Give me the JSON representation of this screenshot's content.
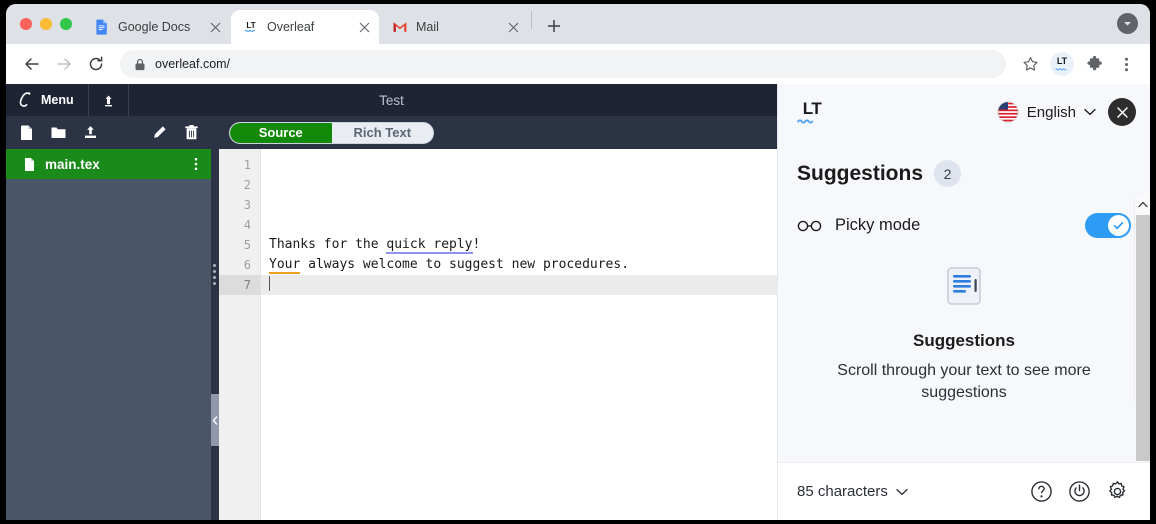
{
  "browser": {
    "tabs": [
      {
        "title": "Google Docs",
        "favicon": "google-docs-icon",
        "active": false
      },
      {
        "title": "Overleaf",
        "favicon": "languagetool-icon",
        "active": true
      },
      {
        "title": "Mail",
        "favicon": "gmail-icon",
        "active": false
      }
    ],
    "new_tab_label": "+",
    "url": "overleaf.com/",
    "toolbar": {
      "back": "back-button",
      "forward": "forward-button",
      "reload": "reload-button",
      "bookmark": "bookmark-star",
      "extension": "LT",
      "puzzle": "extensions-puzzle",
      "menu": "chrome-menu"
    }
  },
  "overleaf": {
    "menu_label": "Menu",
    "project_title": "Test",
    "file_toolbar": [
      "new-file-icon",
      "new-folder-icon",
      "upload-icon",
      "rename-icon",
      "delete-icon"
    ],
    "file_name": "main.tex",
    "view_toggle": {
      "source_label": "Source",
      "rich_text_label": "Rich Text",
      "active": "Source"
    },
    "editor": {
      "line_numbers": [
        "1",
        "2",
        "3",
        "4",
        "5",
        "6",
        "7"
      ],
      "current_line": 7,
      "lines": [
        {
          "n": "1",
          "segments": []
        },
        {
          "n": "2",
          "segments": []
        },
        {
          "n": "3",
          "segments": []
        },
        {
          "n": "4",
          "segments": []
        },
        {
          "n": "5",
          "segments": [
            {
              "text": "Thanks for the ",
              "mark": "none"
            },
            {
              "text": "quick reply",
              "mark": "style"
            },
            {
              "text": "!",
              "mark": "none"
            }
          ]
        },
        {
          "n": "6",
          "segments": [
            {
              "text": "Your",
              "mark": "grammar"
            },
            {
              "text": " always welcome to suggest new procedures.",
              "mark": "none"
            }
          ]
        },
        {
          "n": "7",
          "segments": []
        }
      ],
      "line5_plain": "Thanks for the quick reply!",
      "line6_plain": "Your always welcome to suggest new procedures."
    }
  },
  "languagetool": {
    "logo_text": "LT",
    "language": "English",
    "flag": "us-flag-icon",
    "close_label": "×",
    "suggestions_title": "Suggestions",
    "suggestions_count": "2",
    "picky_mode_label": "Picky mode",
    "picky_mode_on": true,
    "empty_state": {
      "icon": "document-lines-icon",
      "title": "Suggestions",
      "subtitle": "Scroll through your text to see more suggestions"
    },
    "footer": {
      "character_count": "85 characters",
      "help_icon": "help-circle-icon",
      "power_icon": "power-icon",
      "settings_icon": "gear-icon"
    }
  },
  "colors": {
    "overleaf_green": "#138a07",
    "overleaf_dark": "#1e2433",
    "lt_blue": "#2e9cf5",
    "style_underline": "#8f94e8",
    "grammar_underline": "#f0a01e"
  }
}
